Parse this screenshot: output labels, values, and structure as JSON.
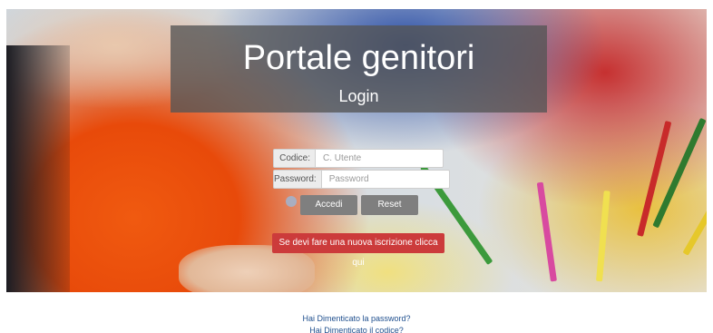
{
  "header": {
    "title": "Portale genitori",
    "subtitle": "Login"
  },
  "login_form": {
    "code_label": "Codice:",
    "code_placeholder": "C. Utente",
    "code_value": "",
    "password_label": "Password:",
    "password_placeholder": "Password",
    "password_value": "",
    "login_button": "Accedi",
    "reset_button": "Reset",
    "register_button": "Se devi fare una nuova iscrizione clicca qui"
  },
  "footer_links": {
    "forgot_password": "Hai Dimenticato la password?",
    "forgot_code": "Hai Dimenticato il codice?"
  },
  "colors": {
    "title_overlay": "#555555",
    "register_button": "#cc3b3b",
    "action_buttons": "#7f7f7f",
    "link": "#1f4f8e"
  }
}
